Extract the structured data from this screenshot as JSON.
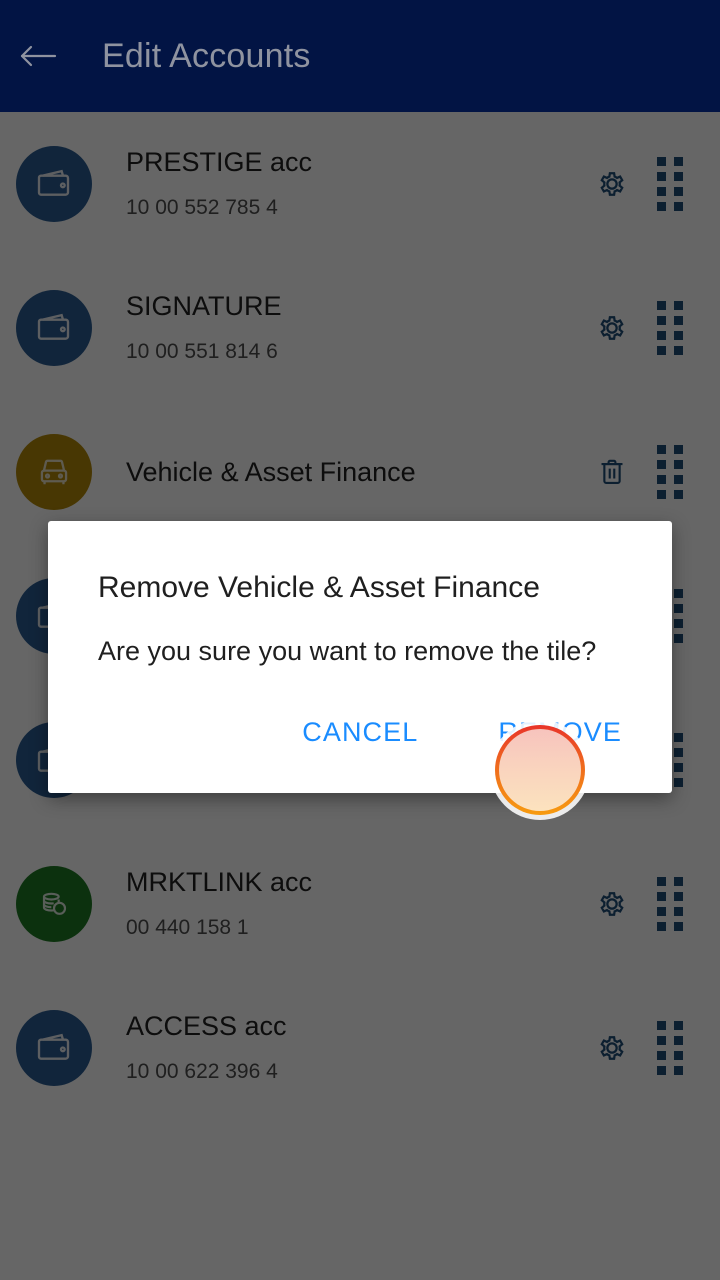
{
  "app": {
    "header": {
      "back_icon": "back-arrow-icon",
      "title": "Edit Accounts",
      "background_color": "#021444",
      "title_color": "#8f93a0"
    },
    "scrim_color": "rgba(0,0,0,0.60)"
  },
  "accounts": [
    {
      "name": "PRESTIGE acc",
      "number": "10 00 552 785 4",
      "avatar_icon": "wallet-icon",
      "avatar_color": "#2b5d93",
      "action_icon": "gear-icon",
      "handle_icon": "drag-handle-icon"
    },
    {
      "name": "SIGNATURE",
      "number": "10 00 551 814 6",
      "avatar_icon": "wallet-icon",
      "avatar_color": "#2b5d93",
      "action_icon": "gear-icon",
      "handle_icon": "drag-handle-icon"
    },
    {
      "name": "Vehicle & Asset Finance",
      "number": "",
      "avatar_icon": "vehicle-icon",
      "avatar_color": "#b58a09",
      "action_icon": "trash-icon",
      "handle_icon": "drag-handle-icon"
    },
    {
      "name": "",
      "number": "",
      "avatar_icon": "wallet-icon",
      "avatar_color": "#2b5d93",
      "action_icon": "gear-icon",
      "handle_icon": "drag-handle-icon"
    },
    {
      "name": "",
      "number": "",
      "avatar_icon": "wallet-icon",
      "avatar_color": "#2b5d93",
      "action_icon": "gear-icon",
      "handle_icon": "drag-handle-icon"
    },
    {
      "name": "MRKTLINK acc",
      "number": "00 440 158 1",
      "avatar_icon": "coins-icon",
      "avatar_color": "#1e7a24",
      "action_icon": "gear-icon",
      "handle_icon": "drag-handle-icon"
    },
    {
      "name": "ACCESS acc",
      "number": "10 00 622 396 4",
      "avatar_icon": "wallet-icon",
      "avatar_color": "#2b5d93",
      "action_icon": "gear-icon",
      "handle_icon": "drag-handle-icon"
    }
  ],
  "dialog": {
    "title": "Remove Vehicle & Asset Finance",
    "message": "Are you sure you want to remove the tile?",
    "cancel_label": "CANCEL",
    "remove_label": "REMOVE",
    "action_color": "#1a8cff",
    "background_color": "#ffffff"
  },
  "tap_indicator": {
    "name": "tap-target-highlight",
    "target": "REMOVE",
    "ring_top_color": "#e8342a",
    "ring_bottom_color": "#f79b10"
  }
}
